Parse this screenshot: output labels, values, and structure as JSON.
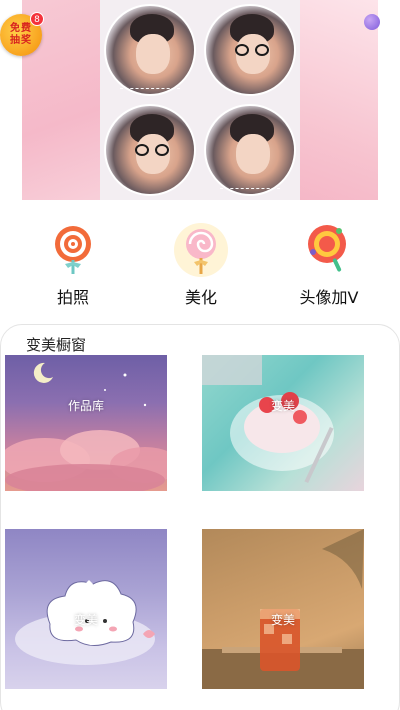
{
  "banner": {
    "badge": {
      "line1": "免费",
      "line2": "抽奖",
      "count": "8"
    }
  },
  "functions": [
    {
      "label": "拍照",
      "icon": "lollipop-spiral-icon"
    },
    {
      "label": "美化",
      "icon": "lollipop-swirl-icon"
    },
    {
      "label": "头像加V",
      "icon": "lollipop-ring-icon"
    }
  ],
  "showcase": {
    "title": "变美橱窗",
    "tiles": [
      {
        "label": "作品库"
      },
      {
        "label": "变美"
      },
      {
        "label": "变美"
      },
      {
        "label": "变美"
      }
    ]
  }
}
